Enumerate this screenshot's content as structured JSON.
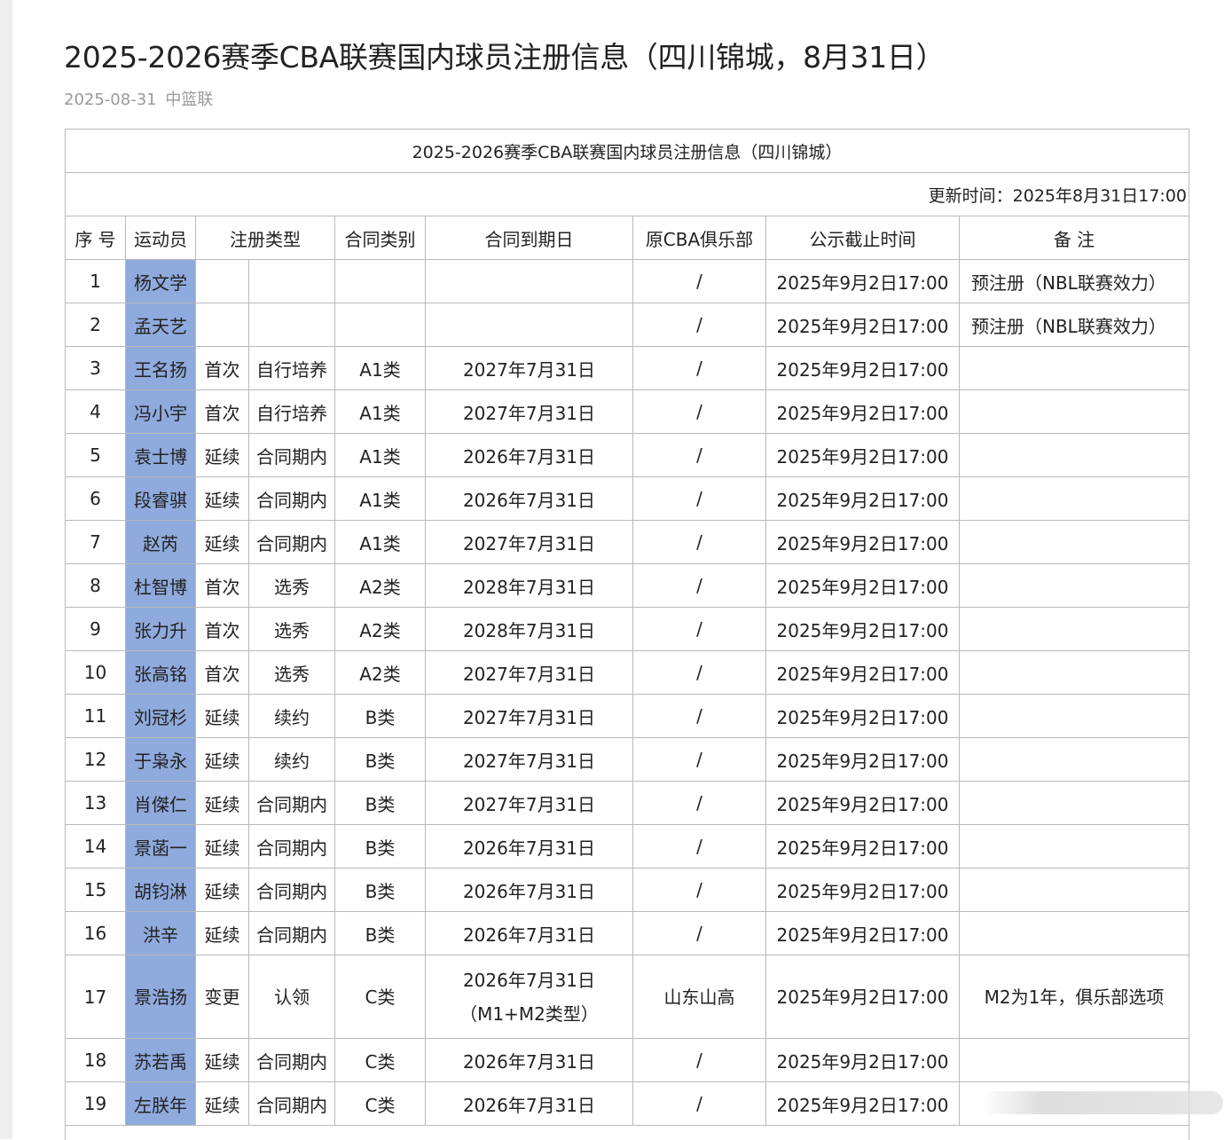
{
  "article": {
    "title": "2025-2026赛季CBA联赛国内球员注册信息（四川锦城，8月31日）",
    "date": "2025-08-31",
    "source": "中篮联"
  },
  "table": {
    "title": "2025-2026赛季CBA联赛国内球员注册信息（四川锦城）",
    "update_time": "更新时间：2025年8月31日17:00",
    "headers": {
      "no": "序 号",
      "athlete": "运动员",
      "reg_type": "注册类型",
      "contract_class": "合同类别",
      "expiry": "合同到期日",
      "former_club": "原CBA俱乐部",
      "deadline": "公示截止时间",
      "remarks": "备 注"
    },
    "rows": [
      {
        "no": "1",
        "name": "杨文学",
        "reg1": "",
        "reg2": "",
        "cls": "",
        "exp": "",
        "exp2": "",
        "club": "/",
        "deadline": "2025年9月2日17:00",
        "note": "预注册（NBL联赛效力）"
      },
      {
        "no": "2",
        "name": "孟天艺",
        "reg1": "",
        "reg2": "",
        "cls": "",
        "exp": "",
        "exp2": "",
        "club": "/",
        "deadline": "2025年9月2日17:00",
        "note": "预注册（NBL联赛效力）"
      },
      {
        "no": "3",
        "name": "王名扬",
        "reg1": "首次",
        "reg2": "自行培养",
        "cls": "A1类",
        "exp": "2027年7月31日",
        "exp2": "",
        "club": "/",
        "deadline": "2025年9月2日17:00",
        "note": ""
      },
      {
        "no": "4",
        "name": "冯小宇",
        "reg1": "首次",
        "reg2": "自行培养",
        "cls": "A1类",
        "exp": "2027年7月31日",
        "exp2": "",
        "club": "/",
        "deadline": "2025年9月2日17:00",
        "note": ""
      },
      {
        "no": "5",
        "name": "袁士博",
        "reg1": "延续",
        "reg2": "合同期内",
        "cls": "A1类",
        "exp": "2026年7月31日",
        "exp2": "",
        "club": "/",
        "deadline": "2025年9月2日17:00",
        "note": ""
      },
      {
        "no": "6",
        "name": "段睿骐",
        "reg1": "延续",
        "reg2": "合同期内",
        "cls": "A1类",
        "exp": "2026年7月31日",
        "exp2": "",
        "club": "/",
        "deadline": "2025年9月2日17:00",
        "note": ""
      },
      {
        "no": "7",
        "name": "赵芮",
        "reg1": "延续",
        "reg2": "合同期内",
        "cls": "A1类",
        "exp": "2027年7月31日",
        "exp2": "",
        "club": "/",
        "deadline": "2025年9月2日17:00",
        "note": ""
      },
      {
        "no": "8",
        "name": "杜智博",
        "reg1": "首次",
        "reg2": "选秀",
        "cls": "A2类",
        "exp": "2028年7月31日",
        "exp2": "",
        "club": "/",
        "deadline": "2025年9月2日17:00",
        "note": ""
      },
      {
        "no": "9",
        "name": "张力升",
        "reg1": "首次",
        "reg2": "选秀",
        "cls": "A2类",
        "exp": "2028年7月31日",
        "exp2": "",
        "club": "/",
        "deadline": "2025年9月2日17:00",
        "note": ""
      },
      {
        "no": "10",
        "name": "张高铭",
        "reg1": "首次",
        "reg2": "选秀",
        "cls": "A2类",
        "exp": "2027年7月31日",
        "exp2": "",
        "club": "/",
        "deadline": "2025年9月2日17:00",
        "note": ""
      },
      {
        "no": "11",
        "name": "刘冠杉",
        "reg1": "延续",
        "reg2": "续约",
        "cls": "B类",
        "exp": "2027年7月31日",
        "exp2": "",
        "club": "/",
        "deadline": "2025年9月2日17:00",
        "note": ""
      },
      {
        "no": "12",
        "name": "于枭永",
        "reg1": "延续",
        "reg2": "续约",
        "cls": "B类",
        "exp": "2027年7月31日",
        "exp2": "",
        "club": "/",
        "deadline": "2025年9月2日17:00",
        "note": ""
      },
      {
        "no": "13",
        "name": "肖傑仁",
        "reg1": "延续",
        "reg2": "合同期内",
        "cls": "B类",
        "exp": "2027年7月31日",
        "exp2": "",
        "club": "/",
        "deadline": "2025年9月2日17:00",
        "note": ""
      },
      {
        "no": "14",
        "name": "景菡一",
        "reg1": "延续",
        "reg2": "合同期内",
        "cls": "B类",
        "exp": "2026年7月31日",
        "exp2": "",
        "club": "/",
        "deadline": "2025年9月2日17:00",
        "note": ""
      },
      {
        "no": "15",
        "name": "胡钧淋",
        "reg1": "延续",
        "reg2": "合同期内",
        "cls": "B类",
        "exp": "2026年7月31日",
        "exp2": "",
        "club": "/",
        "deadline": "2025年9月2日17:00",
        "note": ""
      },
      {
        "no": "16",
        "name": "洪辛",
        "reg1": "延续",
        "reg2": "合同期内",
        "cls": "B类",
        "exp": "2026年7月31日",
        "exp2": "",
        "club": "/",
        "deadline": "2025年9月2日17:00",
        "note": ""
      },
      {
        "no": "17",
        "name": "景浩扬",
        "reg1": "变更",
        "reg2": "认领",
        "cls": "C类",
        "exp": "2026年7月31日",
        "exp2": "（M1+M2类型）",
        "club": "山东山高",
        "deadline": "2025年9月2日17:00",
        "note": "M2为1年，俱乐部选项"
      },
      {
        "no": "18",
        "name": "苏若禹",
        "reg1": "延续",
        "reg2": "合同期内",
        "cls": "C类",
        "exp": "2026年7月31日",
        "exp2": "",
        "club": "/",
        "deadline": "2025年9月2日17:00",
        "note": ""
      },
      {
        "no": "19",
        "name": "左朕年",
        "reg1": "延续",
        "reg2": "合同期内",
        "cls": "C类",
        "exp": "2026年7月31日",
        "exp2": "",
        "club": "/",
        "deadline": "2025年9月2日17:00",
        "note": ""
      }
    ]
  },
  "colors": {
    "athlete_bg": "#8faadc",
    "border": "#b9b9b9",
    "meta_text": "#9a9a9a"
  }
}
